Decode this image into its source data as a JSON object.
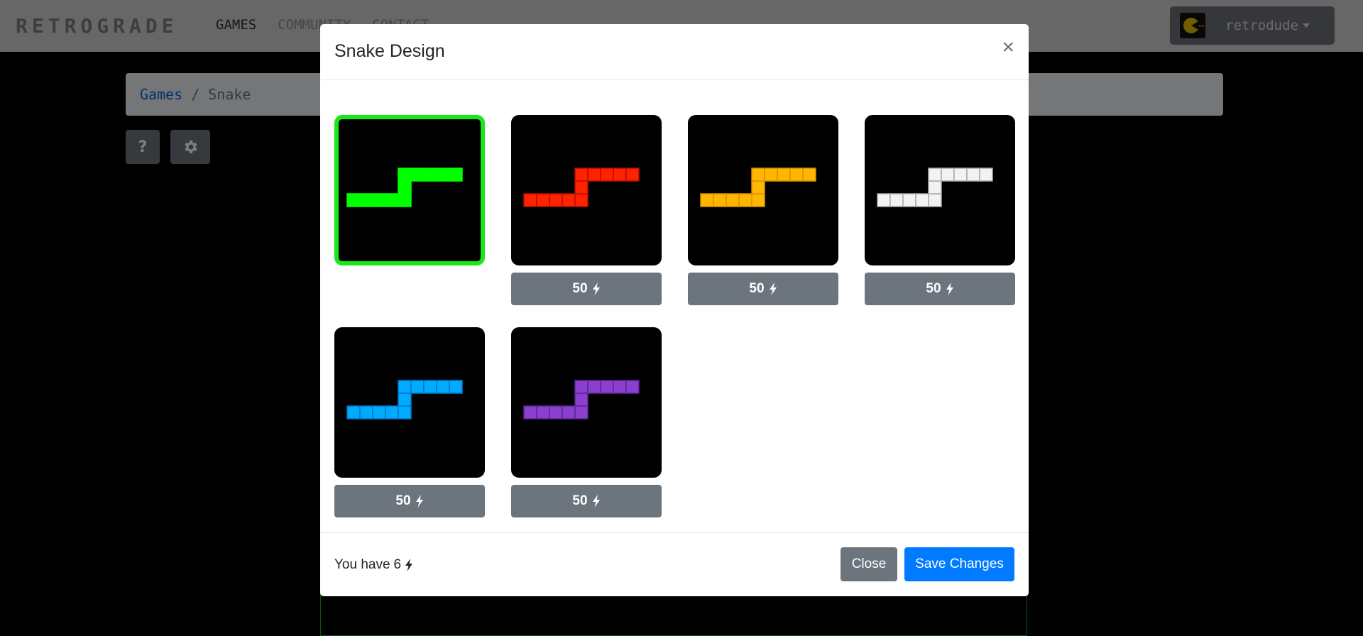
{
  "navbar": {
    "brand": "RETROGRADE",
    "links": [
      "GAMES",
      "COMMUNITY",
      "CONTACT"
    ],
    "username": "retrodude"
  },
  "breadcrumb": {
    "parent": "Games",
    "separator": "/",
    "current": "Snake"
  },
  "toolbar": {
    "help_label": "?"
  },
  "modal": {
    "title": "Snake Design",
    "close_symbol": "×",
    "designs": [
      {
        "name": "green",
        "color": "#00ff00",
        "cell_border": "#00ff00",
        "selected": true,
        "price": ""
      },
      {
        "name": "red",
        "color": "#ff2200",
        "cell_border": "#b01000",
        "selected": false,
        "price": "50"
      },
      {
        "name": "yellow",
        "color": "#ffb600",
        "cell_border": "#d98f00",
        "selected": false,
        "price": "50"
      },
      {
        "name": "white",
        "color": "#f2f2f2",
        "cell_border": "#a9a9a9",
        "selected": false,
        "price": "50"
      },
      {
        "name": "blue",
        "color": "#00aaff",
        "cell_border": "#0075cc",
        "selected": false,
        "price": "50"
      },
      {
        "name": "purple",
        "color": "#8a3fcf",
        "cell_border": "#5e2596",
        "selected": false,
        "price": "50"
      }
    ],
    "price_icon": "bolt-icon",
    "footer": {
      "balance_prefix": "You have",
      "balance_value": "6",
      "close_label": "Close",
      "save_label": "Save Changes"
    }
  }
}
